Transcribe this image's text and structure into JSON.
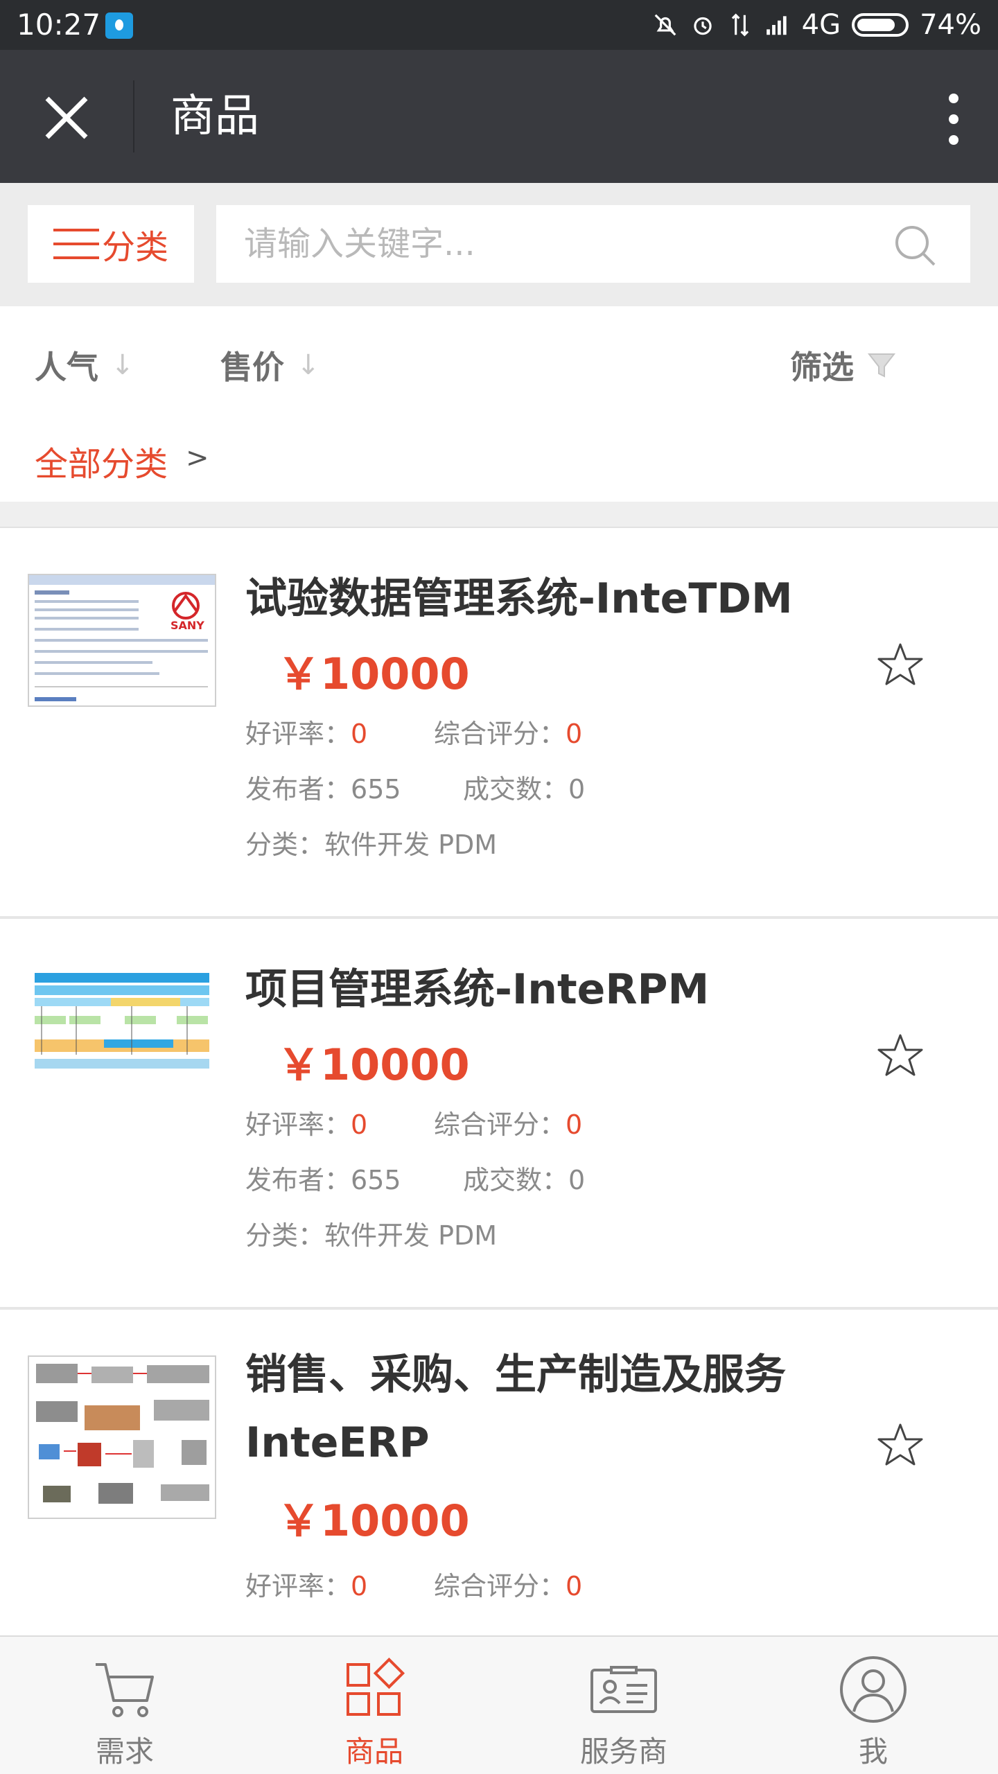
{
  "status_bar": {
    "time": "10:27",
    "network": "4G",
    "battery": "74%"
  },
  "titlebar": {
    "title": "商品"
  },
  "search": {
    "category_label": "分类",
    "placeholder": "请输入关键字..."
  },
  "sort": {
    "popularity": "人气",
    "price": "售价",
    "filter": "筛选"
  },
  "breadcrumb": {
    "label": "全部分类",
    "arrow": ">"
  },
  "labels": {
    "rating_rate": "好评率：",
    "overall_score": "综合评分：",
    "publisher": "发布者：",
    "deals": "成交数：",
    "category": "分类："
  },
  "products": [
    {
      "title_line1": "试验数据管理系统-InteTDM",
      "title_line2": "",
      "price": "￥10000",
      "rating_rate": "0",
      "overall_score": "0",
      "publisher": "655",
      "deals": "0",
      "category": "软件开发 PDM",
      "thumb_text": "SANY"
    },
    {
      "title_line1": "项目管理系统-InteRPM",
      "title_line2": "",
      "price": "￥10000",
      "rating_rate": "0",
      "overall_score": "0",
      "publisher": "655",
      "deals": "0",
      "category": "软件开发 PDM",
      "thumb_text": ""
    },
    {
      "title_line1": "销售、采购、生产制造及服务",
      "title_line2": "InteERP",
      "price": "￥10000",
      "rating_rate": "0",
      "overall_score": "0",
      "publisher": "",
      "deals": "",
      "category": "",
      "thumb_text": ""
    }
  ],
  "tabs": [
    {
      "label": "需求",
      "icon": "cart-icon",
      "active": false
    },
    {
      "label": "商品",
      "icon": "goods-grid-icon",
      "active": true
    },
    {
      "label": "服务商",
      "icon": "id-card-icon",
      "active": false
    },
    {
      "label": "我",
      "icon": "user-icon",
      "active": false
    }
  ],
  "colors": {
    "accent": "#e64a2e",
    "titlebar": "#393a3f",
    "statusbar": "#2b2d30"
  }
}
